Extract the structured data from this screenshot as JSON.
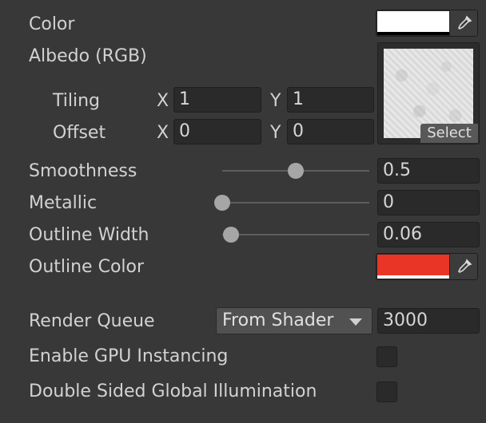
{
  "color": {
    "label": "Color",
    "value_hex": "#ffffff",
    "picker_icon": "eyedropper-icon"
  },
  "albedo": {
    "label": "Albedo (RGB)",
    "tiling": {
      "label": "Tiling",
      "x_label": "X",
      "x": "1",
      "y_label": "Y",
      "y": "1"
    },
    "offset": {
      "label": "Offset",
      "x_label": "X",
      "x": "0",
      "y_label": "Y",
      "y": "0"
    },
    "texture_button": "Select"
  },
  "smoothness": {
    "label": "Smoothness",
    "value": "0.5",
    "slider_fraction": 0.5
  },
  "metallic": {
    "label": "Metallic",
    "value": "0",
    "slider_fraction": 0
  },
  "outline_width": {
    "label": "Outline Width",
    "value": "0.06",
    "slider_fraction": 0.06
  },
  "outline_color": {
    "label": "Outline Color",
    "value_hex": "#e83526",
    "picker_icon": "eyedropper-icon"
  },
  "render_queue": {
    "label": "Render Queue",
    "mode": "From Shader",
    "value": "3000"
  },
  "gpu_instancing": {
    "label": "Enable GPU Instancing",
    "checked": false
  },
  "double_sided_gi": {
    "label": "Double Sided Global Illumination",
    "checked": false
  }
}
